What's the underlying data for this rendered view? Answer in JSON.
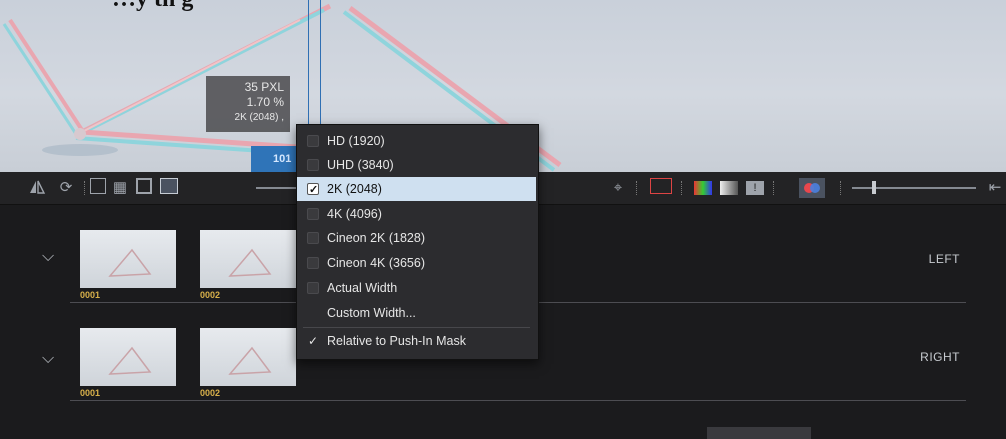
{
  "viewer": {
    "heading_fragment": "…y  th    g",
    "measure": {
      "pixels": "35 PXL",
      "percent": "1.70 %",
      "width": "2K (2048) ,"
    },
    "blue_readout": "101"
  },
  "menu": {
    "items": [
      {
        "label": "HD (1920)",
        "checked": false
      },
      {
        "label": "UHD (3840)",
        "checked": false
      },
      {
        "label": "2K (2048)",
        "checked": true
      },
      {
        "label": "4K (4096)",
        "checked": false
      },
      {
        "label": "Cineon 2K (1828)",
        "checked": false
      },
      {
        "label": "Cineon 4K (3656)",
        "checked": false
      },
      {
        "label": "Actual Width",
        "checked": false
      },
      {
        "label": "Custom Width...",
        "checked": false
      }
    ],
    "relative": {
      "label": "Relative to Push-In Mask",
      "checked_mark": "✓"
    }
  },
  "filmstrip": {
    "left": {
      "label": "LEFT",
      "thumbs": [
        "0001",
        "0002"
      ]
    },
    "right": {
      "label": "RIGHT",
      "thumbs": [
        "0001",
        "0002"
      ]
    }
  },
  "colors": {
    "accent_blue": "#2f74b8",
    "selected_row": "#cfe0f0",
    "frame_number": "#d8b04a"
  }
}
